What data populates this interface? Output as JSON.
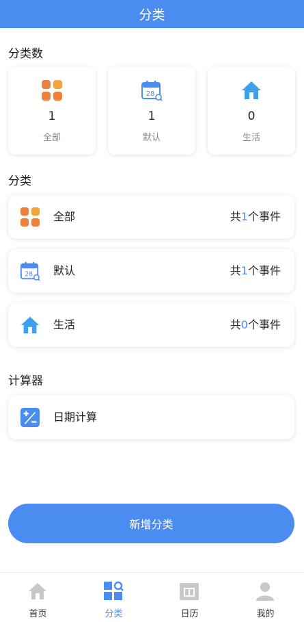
{
  "header": {
    "title": "分类"
  },
  "stats": {
    "title": "分类数",
    "items": [
      {
        "count": "1",
        "label": "全部",
        "icon": "grid-icon"
      },
      {
        "count": "1",
        "label": "默认",
        "icon": "calendar-icon"
      },
      {
        "count": "0",
        "label": "生活",
        "icon": "house-icon"
      }
    ]
  },
  "categories": {
    "title": "分类",
    "items": [
      {
        "name": "全部",
        "count_prefix": "共",
        "count": "1",
        "count_suffix": "个事件",
        "icon": "grid-icon"
      },
      {
        "name": "默认",
        "count_prefix": "共",
        "count": "1",
        "count_suffix": "个事件",
        "icon": "calendar-icon"
      },
      {
        "name": "生活",
        "count_prefix": "共",
        "count": "0",
        "count_suffix": "个事件",
        "icon": "house-icon"
      }
    ]
  },
  "calculator": {
    "title": "计算器",
    "items": [
      {
        "name": "日期计算",
        "icon": "plus-minus-icon"
      }
    ]
  },
  "add_button": {
    "label": "新增分类"
  },
  "tabbar": {
    "items": [
      {
        "label": "首页",
        "icon": "home-icon",
        "active": false
      },
      {
        "label": "分类",
        "icon": "category-search-icon",
        "active": true
      },
      {
        "label": "日历",
        "icon": "calendar-30-icon",
        "active": false
      },
      {
        "label": "我的",
        "icon": "user-icon",
        "active": false
      }
    ]
  },
  "colors": {
    "primary": "#4a8cf0",
    "orange": "#f07f3c",
    "light_blue": "#3ea0ea",
    "tab_gray": "#c8c8c8"
  },
  "calendar_icon_day": "28"
}
